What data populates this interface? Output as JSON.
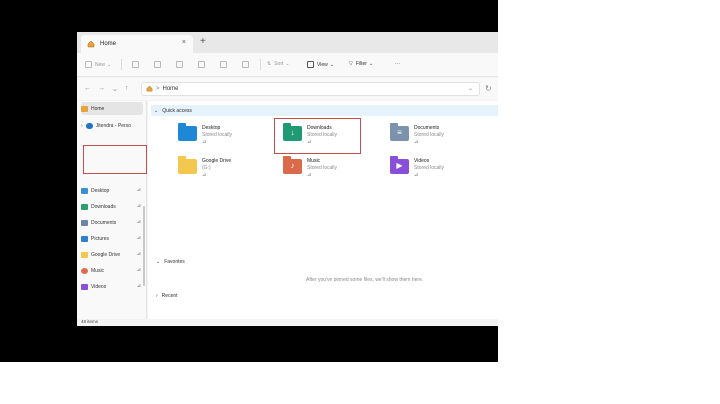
{
  "tab": {
    "title": "Home",
    "close": "×",
    "new": "+"
  },
  "toolbar": {
    "new": "New",
    "sort": "Sort",
    "view": "View",
    "filter": "Filter",
    "more": "···"
  },
  "nav": {
    "back": "←",
    "forward": "→",
    "recent": "⌄",
    "up": "↑",
    "path": "Home",
    "separator": ">",
    "dropdown": "⌄",
    "refresh": "↻"
  },
  "sidebar": {
    "items": [
      {
        "label": "Home",
        "icon": "home-icon",
        "color": "#e8a23a"
      },
      {
        "label": "Jitendra - Perso",
        "icon": "cloud-icon",
        "color": "#1e74c8"
      },
      {
        "label": "Desktop",
        "icon": "desktop-icon",
        "color": "#3a8fd6",
        "pin": "⊿"
      },
      {
        "label": "Downloads",
        "icon": "downloads-icon",
        "color": "#2aa06f",
        "pin": "⊿"
      },
      {
        "label": "Documents",
        "icon": "documents-icon",
        "color": "#6b86a8",
        "pin": "⊿"
      },
      {
        "label": "Pictures",
        "icon": "pictures-icon",
        "color": "#2f7fd1",
        "pin": "⊿"
      },
      {
        "label": "Google Drive",
        "icon": "folder-icon",
        "color": "#f2c94c",
        "pin": "⊿"
      },
      {
        "label": "Music",
        "icon": "music-icon",
        "color": "#e06b4f",
        "pin": "⊿"
      },
      {
        "label": "Videos",
        "icon": "videos-icon",
        "color": "#8a4fd8",
        "pin": "⊿"
      }
    ]
  },
  "main": {
    "quick_access": "Quick access",
    "folders": [
      {
        "name": "Desktop",
        "sub": "Stored locally",
        "pin": "⊿",
        "color": "#1f88d6",
        "glyph": ""
      },
      {
        "name": "Downloads",
        "sub": "Stored locally",
        "pin": "⊿",
        "color": "#1f9a73",
        "glyph": "↓"
      },
      {
        "name": "Documents",
        "sub": "Stored locally",
        "pin": "⊿",
        "color": "#7c93ad",
        "glyph": "≡"
      },
      {
        "name": "Google Drive",
        "sub": "(G:)",
        "pin": "⊿",
        "color": "#f4c84f",
        "glyph": ""
      },
      {
        "name": "Music",
        "sub": "Stored locally",
        "pin": "⊿",
        "color": "#d96a4a",
        "glyph": "♪"
      },
      {
        "name": "Videos",
        "sub": "Stored locally",
        "pin": "⊿",
        "color": "#8a4fd8",
        "glyph": "▶"
      }
    ],
    "favorites": "Favorites",
    "favorites_empty": "After you've pinned some files, we'll show them here.",
    "recent": "Recent"
  },
  "status": {
    "items": "48 items"
  },
  "colors": {
    "highlight": "#c0504d",
    "accent": "#e5f1fb"
  }
}
